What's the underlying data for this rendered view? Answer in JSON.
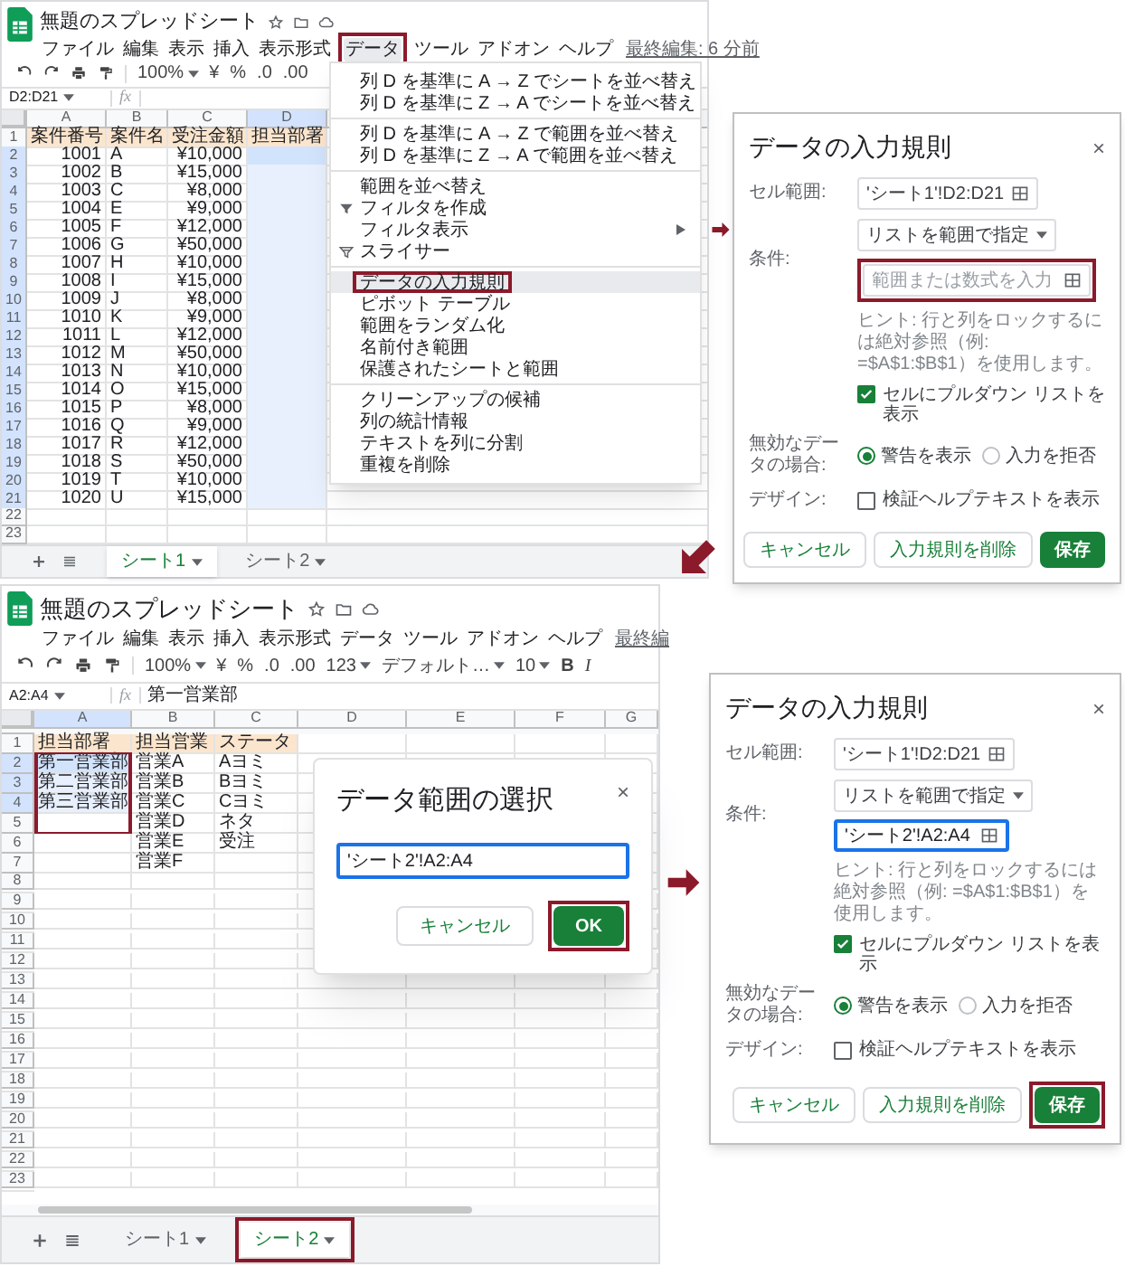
{
  "step_1_sheet": {
    "title": "無題のスプレッドシート",
    "menu": [
      {
        "label": "ファイル",
        "selected": false,
        "highlighted": false
      },
      {
        "label": "編集",
        "selected": false,
        "highlighted": false
      },
      {
        "label": "表示",
        "selected": false,
        "highlighted": false
      },
      {
        "label": "挿入",
        "selected": false,
        "highlighted": false
      },
      {
        "label": "表示形式",
        "selected": false,
        "highlighted": false
      },
      {
        "label": "データ",
        "selected": true,
        "highlighted": true
      },
      {
        "label": "ツール",
        "selected": false,
        "highlighted": false
      },
      {
        "label": "アドオン",
        "selected": false,
        "highlighted": false
      },
      {
        "label": "ヘルプ",
        "selected": false,
        "highlighted": false
      }
    ],
    "last_edit": "最終編集: 6 分前",
    "toolbar": [
      {
        "label": "100%",
        "kind": "dropdown"
      },
      {
        "label": "¥",
        "kind": "text"
      },
      {
        "label": "%",
        "kind": "text"
      },
      {
        "label": ".0",
        "kind": "text"
      },
      {
        "label": ".00",
        "kind": "text"
      }
    ],
    "name_box": "D2:D21",
    "fx": "fx",
    "columns": [
      {
        "letter": "A",
        "selected": false
      },
      {
        "letter": "B",
        "selected": false
      },
      {
        "letter": "C",
        "selected": false
      },
      {
        "letter": "D",
        "selected": true
      }
    ],
    "rows": [
      {
        "number": "1",
        "kind": "header",
        "selected": false,
        "cells": {
          "A": "案件番号",
          "B": "案件名",
          "C": "受注金額",
          "D": "担当部署"
        }
      },
      {
        "number": "2",
        "kind": "data",
        "selected": true,
        "cells": {
          "A": "1001",
          "B": "A",
          "C": "¥10,000"
        }
      },
      {
        "number": "3",
        "kind": "data",
        "selected": true,
        "cells": {
          "A": "1002",
          "B": "B",
          "C": "¥15,000"
        }
      },
      {
        "number": "4",
        "kind": "data",
        "selected": true,
        "cells": {
          "A": "1003",
          "B": "C",
          "C": "¥8,000"
        }
      },
      {
        "number": "5",
        "kind": "data",
        "selected": true,
        "cells": {
          "A": "1004",
          "B": "E",
          "C": "¥9,000"
        }
      },
      {
        "number": "6",
        "kind": "data",
        "selected": true,
        "cells": {
          "A": "1005",
          "B": "F",
          "C": "¥12,000"
        }
      },
      {
        "number": "7",
        "kind": "data",
        "selected": true,
        "cells": {
          "A": "1006",
          "B": "G",
          "C": "¥50,000"
        }
      },
      {
        "number": "8",
        "kind": "data",
        "selected": true,
        "cells": {
          "A": "1007",
          "B": "H",
          "C": "¥10,000"
        }
      },
      {
        "number": "9",
        "kind": "data",
        "selected": true,
        "cells": {
          "A": "1008",
          "B": "I",
          "C": "¥15,000"
        }
      },
      {
        "number": "10",
        "kind": "data",
        "selected": true,
        "cells": {
          "A": "1009",
          "B": "J",
          "C": "¥8,000"
        }
      },
      {
        "number": "11",
        "kind": "data",
        "selected": true,
        "cells": {
          "A": "1010",
          "B": "K",
          "C": "¥9,000"
        }
      },
      {
        "number": "12",
        "kind": "data",
        "selected": true,
        "cells": {
          "A": "1011",
          "B": "L",
          "C": "¥12,000"
        }
      },
      {
        "number": "13",
        "kind": "data",
        "selected": true,
        "cells": {
          "A": "1012",
          "B": "M",
          "C": "¥50,000"
        }
      },
      {
        "number": "14",
        "kind": "data",
        "selected": true,
        "cells": {
          "A": "1013",
          "B": "N",
          "C": "¥10,000"
        }
      },
      {
        "number": "15",
        "kind": "data",
        "selected": true,
        "cells": {
          "A": "1014",
          "B": "O",
          "C": "¥15,000"
        }
      },
      {
        "number": "16",
        "kind": "data",
        "selected": true,
        "cells": {
          "A": "1015",
          "B": "P",
          "C": "¥8,000"
        }
      },
      {
        "number": "17",
        "kind": "data",
        "selected": true,
        "cells": {
          "A": "1016",
          "B": "Q",
          "C": "¥9,000"
        }
      },
      {
        "number": "18",
        "kind": "data",
        "selected": true,
        "cells": {
          "A": "1017",
          "B": "R",
          "C": "¥12,000"
        }
      },
      {
        "number": "19",
        "kind": "data",
        "selected": true,
        "cells": {
          "A": "1018",
          "B": "S",
          "C": "¥50,000"
        }
      },
      {
        "number": "20",
        "kind": "data",
        "selected": true,
        "cells": {
          "A": "1019",
          "B": "T",
          "C": "¥10,000"
        }
      },
      {
        "number": "21",
        "kind": "data",
        "selected": true,
        "cells": {
          "A": "1020",
          "B": "U",
          "C": "¥15,000"
        }
      },
      {
        "number": "22",
        "kind": "data",
        "selected": false
      },
      {
        "number": "23",
        "kind": "data",
        "selected": false
      }
    ],
    "tabs": [
      {
        "label": "シート1",
        "selected": true,
        "highlighted": false
      },
      {
        "label": "シート2",
        "selected": false,
        "highlighted": false
      }
    ],
    "data_menu": [
      {
        "kind": "item",
        "label": "列 D を基準に A → Z でシートを並べ替え"
      },
      {
        "kind": "item",
        "label": "列 D を基準に Z → A でシートを並べ替え"
      },
      {
        "kind": "divider"
      },
      {
        "kind": "item",
        "label": "列 D を基準に A → Z で範囲を並べ替え"
      },
      {
        "kind": "item",
        "label": "列 D を基準に Z → A で範囲を並べ替え"
      },
      {
        "kind": "divider"
      },
      {
        "kind": "item",
        "label": "範囲を並べ替え"
      },
      {
        "kind": "filter",
        "label": "フィルタを作成"
      },
      {
        "kind": "item",
        "label": "フィルタ表示",
        "submenu": true
      },
      {
        "kind": "slicer",
        "label": "スライサー"
      },
      {
        "kind": "divider"
      },
      {
        "kind": "item",
        "label": "データの入力規則",
        "hovered": true,
        "highlighted": true
      },
      {
        "kind": "item",
        "label": "ピボット テーブル"
      },
      {
        "kind": "item",
        "label": "範囲をランダム化"
      },
      {
        "kind": "item",
        "label": "名前付き範囲"
      },
      {
        "kind": "item",
        "label": "保護されたシートと範囲"
      },
      {
        "kind": "divider"
      },
      {
        "kind": "item",
        "label": "クリーンアップの候補"
      },
      {
        "kind": "item",
        "label": "列の統計情報"
      },
      {
        "kind": "item",
        "label": "テキストを列に分割"
      },
      {
        "kind": "item",
        "label": "重複を削除"
      }
    ]
  },
  "step_2_dialog": {
    "title": "データの入力規則",
    "close": "×",
    "cell_range": {
      "label": "セル範囲:",
      "value": "'シート1'!D2:D21"
    },
    "criteria": {
      "label": "条件:",
      "dropdown": "リストを範囲で指定",
      "range_field": {
        "placeholder": "範囲または数式を入力",
        "focused": false,
        "highlighted": true
      }
    },
    "hint": "ヒント: 行と列をロックするには絶対参照（例: =$A$1:$B$1）を使用します。",
    "dropdown_checkbox": {
      "label": "セルにプルダウン リストを表示",
      "checked": true
    },
    "invalid_data": {
      "label": "無効なデータの場合:",
      "options": [
        {
          "label": "警告を表示",
          "selected": true
        },
        {
          "label": "入力を拒否",
          "selected": false
        }
      ]
    },
    "design": {
      "label": "デザイン:",
      "checkbox": {
        "label": "検証ヘルプテキストを表示",
        "checked": false
      }
    },
    "buttons": [
      {
        "label": "キャンセル",
        "kind": "secondary",
        "highlighted": false
      },
      {
        "label": "入力規則を削除",
        "kind": "secondary",
        "highlighted": false
      },
      {
        "label": "保存",
        "kind": "primary",
        "highlighted": false
      }
    ]
  },
  "step_3_sheet": {
    "title": "無題のスプレッドシート",
    "menu": [
      {
        "label": "ファイル",
        "selected": false,
        "highlighted": false
      },
      {
        "label": "編集",
        "selected": false,
        "highlighted": false
      },
      {
        "label": "表示",
        "selected": false,
        "highlighted": false
      },
      {
        "label": "挿入",
        "selected": false,
        "highlighted": false
      },
      {
        "label": "表示形式",
        "selected": false,
        "highlighted": false
      },
      {
        "label": "データ",
        "selected": false,
        "highlighted": false
      },
      {
        "label": "ツール",
        "selected": false,
        "highlighted": false
      },
      {
        "label": "アドオン",
        "selected": false,
        "highlighted": false
      },
      {
        "label": "ヘルプ",
        "selected": false,
        "highlighted": false
      }
    ],
    "last_edit": "最終編",
    "toolbar": [
      {
        "label": "100%",
        "kind": "dropdown"
      },
      {
        "label": "¥",
        "kind": "text"
      },
      {
        "label": "%",
        "kind": "text"
      },
      {
        "label": ".0",
        "kind": "text"
      },
      {
        "label": ".00",
        "kind": "text"
      },
      {
        "label": "123",
        "kind": "dropdown"
      },
      {
        "label": "デフォルト…",
        "kind": "dropdown"
      },
      {
        "label": "10",
        "kind": "dropdown"
      },
      {
        "label": "B",
        "kind": "bold"
      },
      {
        "label": "I",
        "kind": "italic"
      }
    ],
    "name_box": "A2:A4",
    "fx": "fx",
    "formula": "第一営業部",
    "columns": [
      {
        "letter": "A",
        "selected": true
      },
      {
        "letter": "B",
        "selected": false
      },
      {
        "letter": "C",
        "selected": false
      },
      {
        "letter": "D",
        "selected": false
      },
      {
        "letter": "E",
        "selected": false
      },
      {
        "letter": "F",
        "selected": false
      },
      {
        "letter": "G",
        "selected": false
      }
    ],
    "rows": [
      {
        "number": "1",
        "kind": "header",
        "selected": false,
        "cells": {
          "A": "担当部署",
          "B": "担当営業",
          "C": "ステータ"
        }
      },
      {
        "number": "2",
        "kind": "data",
        "selected": true,
        "cells": {
          "A": "第一営業部",
          "B": "営業A",
          "C": "Aヨミ"
        }
      },
      {
        "number": "3",
        "kind": "data",
        "selected": true,
        "cells": {
          "A": "第二営業部",
          "B": "営業B",
          "C": "Bヨミ"
        }
      },
      {
        "number": "4",
        "kind": "data",
        "selected": true,
        "cells": {
          "A": "第三営業部",
          "B": "営業C",
          "C": "Cヨミ"
        }
      },
      {
        "number": "5",
        "kind": "data",
        "selected": false,
        "cells": {
          "B": "営業D",
          "C": "ネタ"
        }
      },
      {
        "number": "6",
        "kind": "data",
        "selected": false,
        "cells": {
          "B": "営業E",
          "C": "受注"
        }
      },
      {
        "number": "7",
        "kind": "data",
        "selected": false,
        "cells": {
          "B": "営業F"
        }
      },
      {
        "number": "8",
        "kind": "data",
        "selected": false
      },
      {
        "number": "9",
        "kind": "data",
        "selected": false
      },
      {
        "number": "10",
        "kind": "data",
        "selected": false
      },
      {
        "number": "11",
        "kind": "data",
        "selected": false
      },
      {
        "number": "12",
        "kind": "data",
        "selected": false
      },
      {
        "number": "13",
        "kind": "data",
        "selected": false
      },
      {
        "number": "14",
        "kind": "data",
        "selected": false
      },
      {
        "number": "15",
        "kind": "data",
        "selected": false
      },
      {
        "number": "16",
        "kind": "data",
        "selected": false
      },
      {
        "number": "17",
        "kind": "data",
        "selected": false
      },
      {
        "number": "18",
        "kind": "data",
        "selected": false
      },
      {
        "number": "19",
        "kind": "data",
        "selected": false
      },
      {
        "number": "20",
        "kind": "data",
        "selected": false
      },
      {
        "number": "21",
        "kind": "data",
        "selected": false
      },
      {
        "number": "22",
        "kind": "data",
        "selected": false
      },
      {
        "number": "23",
        "kind": "data",
        "selected": false
      }
    ],
    "range_highlighted": true,
    "tabs": [
      {
        "label": "シート1",
        "selected": false,
        "highlighted": false
      },
      {
        "label": "シート2",
        "selected": true,
        "highlighted": true
      }
    ],
    "range_dialog": {
      "title": "データ範囲の選択",
      "close": "×",
      "value": "'シート2'!A2:A4",
      "buttons": [
        {
          "label": "キャンセル",
          "kind": "secondary",
          "highlighted": false
        },
        {
          "label": "OK",
          "kind": "primary",
          "highlighted": true
        }
      ]
    }
  },
  "step_4_dialog": {
    "title": "データの入力規則",
    "close": "×",
    "cell_range": {
      "label": "セル範囲:",
      "value": "'シート1'!D2:D21"
    },
    "criteria": {
      "label": "条件:",
      "dropdown": "リストを範囲で指定",
      "range_field": {
        "value": "'シート2'!A2:A4",
        "focused": true,
        "highlighted": false
      }
    },
    "hint": "ヒント: 行と列をロックするには絶対参照（例: =$A$1:$B$1）を使用します。",
    "dropdown_checkbox": {
      "label": "セルにプルダウン リストを表示",
      "checked": true
    },
    "invalid_data": {
      "label": "無効なデータの場合:",
      "options": [
        {
          "label": "警告を表示",
          "selected": true
        },
        {
          "label": "入力を拒否",
          "selected": false
        }
      ]
    },
    "design": {
      "label": "デザイン:",
      "checkbox": {
        "label": "検証ヘルプテキストを表示",
        "checked": false
      }
    },
    "buttons": [
      {
        "label": "キャンセル",
        "kind": "secondary",
        "highlighted": false
      },
      {
        "label": "入力規則を削除",
        "kind": "secondary",
        "highlighted": false
      },
      {
        "label": "保存",
        "kind": "primary",
        "highlighted": true
      }
    ]
  }
}
